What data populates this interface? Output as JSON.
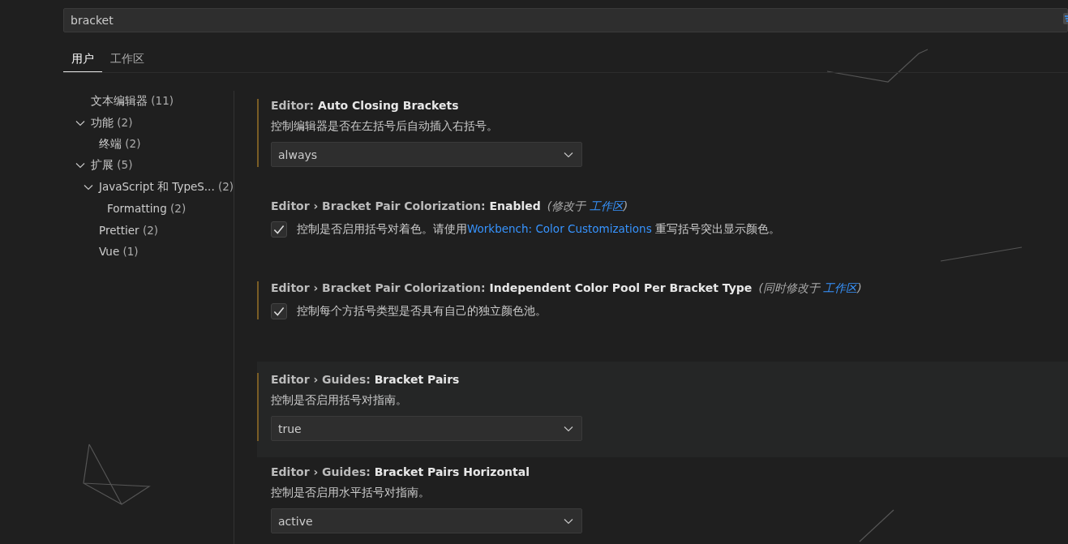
{
  "search": {
    "value": "bracket"
  },
  "tabs": [
    {
      "label": "用户",
      "selected": true
    },
    {
      "label": "工作区",
      "selected": false
    }
  ],
  "toc": [
    {
      "label": "文本编辑器",
      "count": "(11)"
    },
    {
      "label": "功能",
      "count": "(2)",
      "expanded": true,
      "children": [
        {
          "label": "终端",
          "count": "(2)"
        }
      ]
    },
    {
      "label": "扩展",
      "count": "(5)",
      "expanded": true,
      "children": [
        {
          "label": "JavaScript 和 TypeS...",
          "count": "(2)",
          "expanded": true,
          "children": [
            {
              "label": "Formatting",
              "count": "(2)"
            }
          ]
        },
        {
          "label": "Prettier",
          "count": "(2)"
        },
        {
          "label": "Vue",
          "count": "(1)"
        }
      ]
    }
  ],
  "settings": [
    {
      "kind": "dropdown",
      "category": "Editor: ",
      "name": "Auto Closing Brackets",
      "modified": true,
      "focused": false,
      "description": "控制编辑器是否在左括号后自动插入右括号。",
      "value": "always"
    },
    {
      "kind": "checkbox",
      "category": "Editor › Bracket Pair Colorization: ",
      "name": "Enabled",
      "modified": false,
      "focused": false,
      "note": {
        "before": "(修改于 ",
        "link": "工作区",
        "after": ")"
      },
      "description": "控制是否启用括号对着色。请使用",
      "link": "Workbench: Color Customizations",
      "description_after": "重写括号突出显示颜色。",
      "checked": true
    },
    {
      "kind": "checkbox",
      "category": "Editor › Bracket Pair Colorization: ",
      "name": "Independent Color Pool Per Bracket Type",
      "modified": true,
      "focused": false,
      "note": {
        "before": "(同时修改于 ",
        "link": "工作区",
        "after": ")"
      },
      "description": "控制每个方括号类型是否具有自己的独立颜色池。",
      "checked": true
    },
    {
      "kind": "dropdown",
      "category": "Editor › Guides: ",
      "name": "Bracket Pairs",
      "modified": true,
      "focused": true,
      "description": "控制是否启用括号对指南。",
      "value": "true"
    },
    {
      "kind": "dropdown",
      "category": "Editor › Guides: ",
      "name": "Bracket Pairs Horizontal",
      "modified": false,
      "focused": false,
      "description": "控制是否启用水平括号对指南。",
      "value": "active"
    }
  ]
}
